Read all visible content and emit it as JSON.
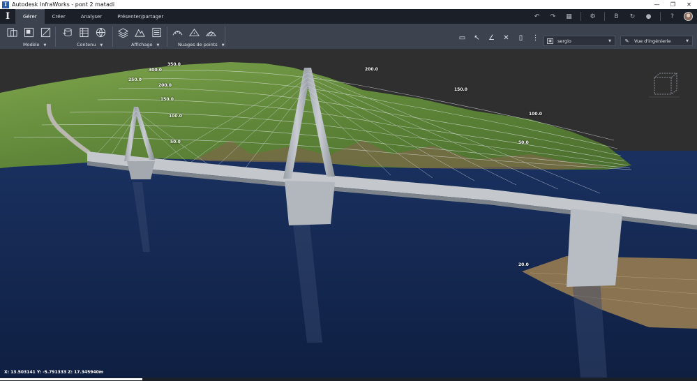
{
  "window": {
    "title": "Autodesk InfraWorks - pont 2 matadi",
    "controls": {
      "minimize": "—",
      "maximize": "❐",
      "close": "✕"
    }
  },
  "tabs": [
    {
      "label": "Gérer",
      "active": true
    },
    {
      "label": "Créer",
      "active": false
    },
    {
      "label": "Analyser",
      "active": false
    },
    {
      "label": "Présenter/partager",
      "active": false
    }
  ],
  "ribbon": {
    "groups": [
      {
        "label": "Modèle"
      },
      {
        "label": "Contenu"
      },
      {
        "label": "Affichage"
      },
      {
        "label": "Nuages de points"
      }
    ],
    "proposal_dropdown": "sergio",
    "view_dropdown": "Vue d'ingénierie"
  },
  "viewport": {
    "contour_labels": [
      "350.0",
      "300.0",
      "250.0",
      "200.0",
      "150.0",
      "100.0",
      "50.0",
      "200.0",
      "150.0",
      "100.0",
      "50.0",
      "20.0"
    ],
    "coordinates": "X: 13.503141 Y: -5.791333 Z: 17.345940m"
  },
  "colors": {
    "ribbon_bg": "#3c434f",
    "tab_bg": "#1b1f27",
    "water": "#15274d",
    "terrain": "#5f8a3a"
  }
}
